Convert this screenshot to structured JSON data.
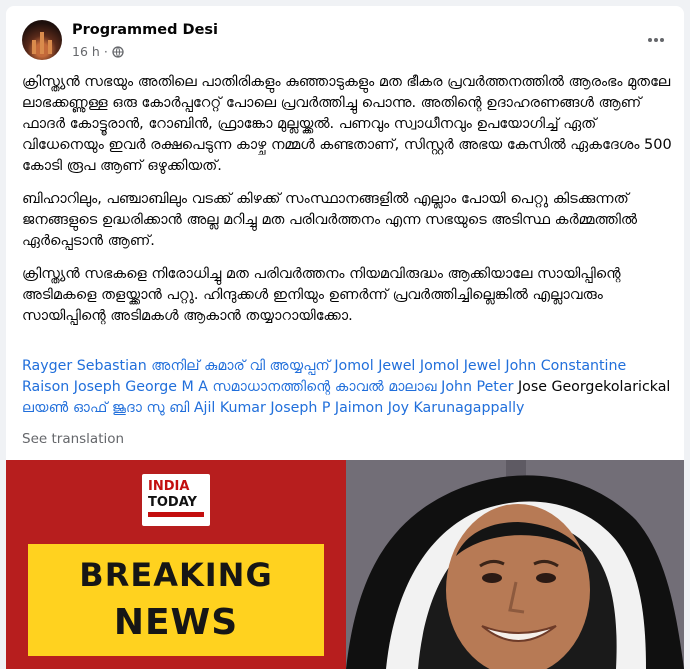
{
  "post": {
    "author": "Programmed Desi",
    "time": "16 h",
    "separator": "·",
    "paragraphs": [
      "ക്രിസ്ത്യൻ സഭയും അതിലെ പാതിരികളും കുഞ്ഞാടുകളും മത ഭീകര പ്രവർത്തനത്തിൽ ആരംഭം മുതലേ ലാഭക്കണ്ണുള്ള ഒരു കോർപ്പറേറ്റ് പോലെ പ്രവർത്തിച്ചു പൊന്നു. അതിന്റെ ഉദാഹരണങ്ങൾ ആണ് ഫാദർ കോട്ടൂരാൻ, റോബിൻ, ഫ്രാങ്കോ മുല്ലയ്ക്കൽ. പണവും സ്വാധീനവും ഉപയോഗിച്ച് ഏത് വിധേനെയും ഇവർ രക്ഷപെടുന്ന കാഴ്ച നമ്മൾ കണ്ടതാണ്, സിസ്റ്റർ അഭയ കേസിൽ ഏകദേശം 500 കോടി രൂപ ആണ് ഒഴുക്കിയത്.",
      "ബിഹാറിലും, പഞ്ചാബിലും വടക്ക് കിഴക്ക് സംസ്ഥാനങ്ങളിൽ എല്ലാം പോയി പെറ്റു കിടക്കുന്നത് ജനങ്ങളുടെ ഉദ്ധരിക്കാൻ അല്ല മറിച്ചു മത പരിവർത്തനം എന്ന സഭയുടെ അടിസ്ഥ കർമ്മത്തിൽ ഏർപ്പെടാൻ ആണ്.",
      "ക്രിസ്ത്യൻ സഭകളെ നിരോധിച്ചു മത പരിവർത്തനം നിയമവിരുദ്ധം ആക്കിയാലേ സായിപ്പിന്റെ അടിമകളെ തളയ്ക്കാൻ പറ്റു. ഹിന്ദുക്കൾ ഇനിയും ഉണർന്ന് പ്രവർത്തിച്ചില്ലെങ്കിൽ എല്ലാവരും സായിപ്പിന്റെ അടിമകൾ ആകാൻ തയ്യാറായിക്കോ."
    ],
    "tags": [
      "Rayger Sebastian",
      "അനില് കുമാര് വി അയ്യപ്പന്",
      "Jomol Jewel Jomol Jewel",
      "John Constantine Raison",
      "Joseph George M A",
      "സമാധാനത്തിന്റെ കാവൽ മാലാഖ",
      "John Peter",
      "Jose Georgekolarickal",
      "ലയൺ ഓഫ് ജൂദാ സു ബി",
      "Ajil Kumar",
      "Joseph P Jaimon",
      "Joy Karunagappally"
    ],
    "see_translation": "See translation"
  },
  "image": {
    "logo_line1": "INDIA",
    "logo_line2": "TODAY",
    "banner_line1": "BREAKING",
    "banner_line2": "NEWS"
  },
  "colors": {
    "link": "#216fdb",
    "meta": "#65676b",
    "banner_red": "#b71e1e",
    "banner_yellow": "#ffd21f"
  }
}
